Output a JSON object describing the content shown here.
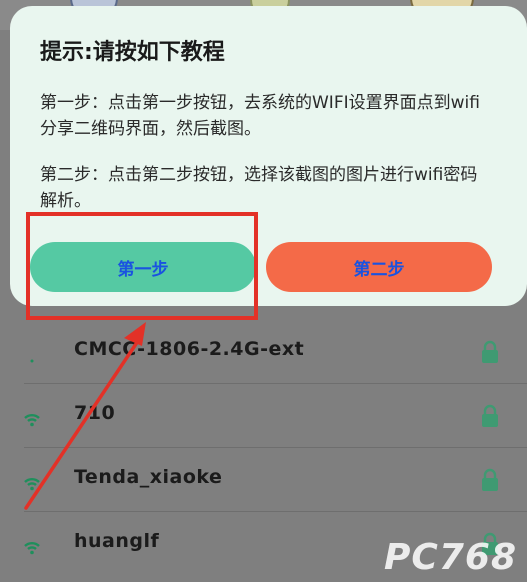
{
  "dialog": {
    "title": "提示:请按如下教程",
    "step1_text": "第一步：点击第一步按钮，去系统的WIFI设置界面点到wifi分享二维码界面，然后截图。",
    "step2_text": "第二步：点击第二步按钮，选择该截图的图片进行wifi密码解析。",
    "button1_label": "第一步",
    "button2_label": "第二步"
  },
  "wifi_list": [
    {
      "ssid": "CMCC-1806-2.4G-ext",
      "locked": true
    },
    {
      "ssid": "710",
      "locked": true
    },
    {
      "ssid": "Tenda_xiaoke",
      "locked": true
    },
    {
      "ssid": "huanglf",
      "locked": true
    }
  ],
  "colors": {
    "button1_bg": "#55c9a3",
    "button2_bg": "#f46a48",
    "button_text": "#1a53e0",
    "highlight": "#e33127",
    "wifi_icon": "#1f8f5c"
  },
  "watermark": "PC768"
}
